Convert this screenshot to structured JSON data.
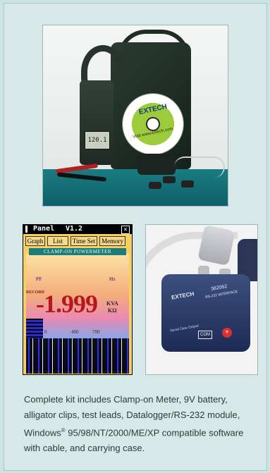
{
  "product_photo": {
    "cd_brand": "EXTECH",
    "cd_small_text": "Visit www.extech.com",
    "meter_reading": "120.1"
  },
  "panel": {
    "window_title": "Panel",
    "version": "V1.2",
    "close_glyph": "×",
    "buttons": [
      "Graph",
      "List",
      "Time Set",
      "Memory"
    ],
    "header_band": "CLAMP-ON POWERMETER",
    "pf_label": "PF",
    "hz_label": "Hz",
    "record_label": "RECORD",
    "main_value": "-1.999",
    "unit_primary": "KVA",
    "unit_secondary": "KΩ",
    "scale_ticks": [
      "0",
      "400",
      "700"
    ]
  },
  "module_photo": {
    "brand": "EXTECH",
    "model": "382062",
    "subtitle": "RS-232 INTERFACE",
    "com_label": "COM",
    "serial_label": "Serial Data Output",
    "plus_glyph": "+"
  },
  "caption": {
    "part1": "Complete kit includes Clamp-on Meter, 9V battery, alligator clips, test leads, Datalogger/RS-232 module, Windows",
    "registered": "®",
    "part2": " 95/98/NT/2000/ME/XP compatible software with cable, and carrying case."
  },
  "colors": {
    "page_bg": "#cde3e2",
    "panel_yellow": "#f6cf5e",
    "value_red": "#b5171d",
    "module_blue": "#2a3a6a",
    "floor_teal": "#1a7c82"
  }
}
